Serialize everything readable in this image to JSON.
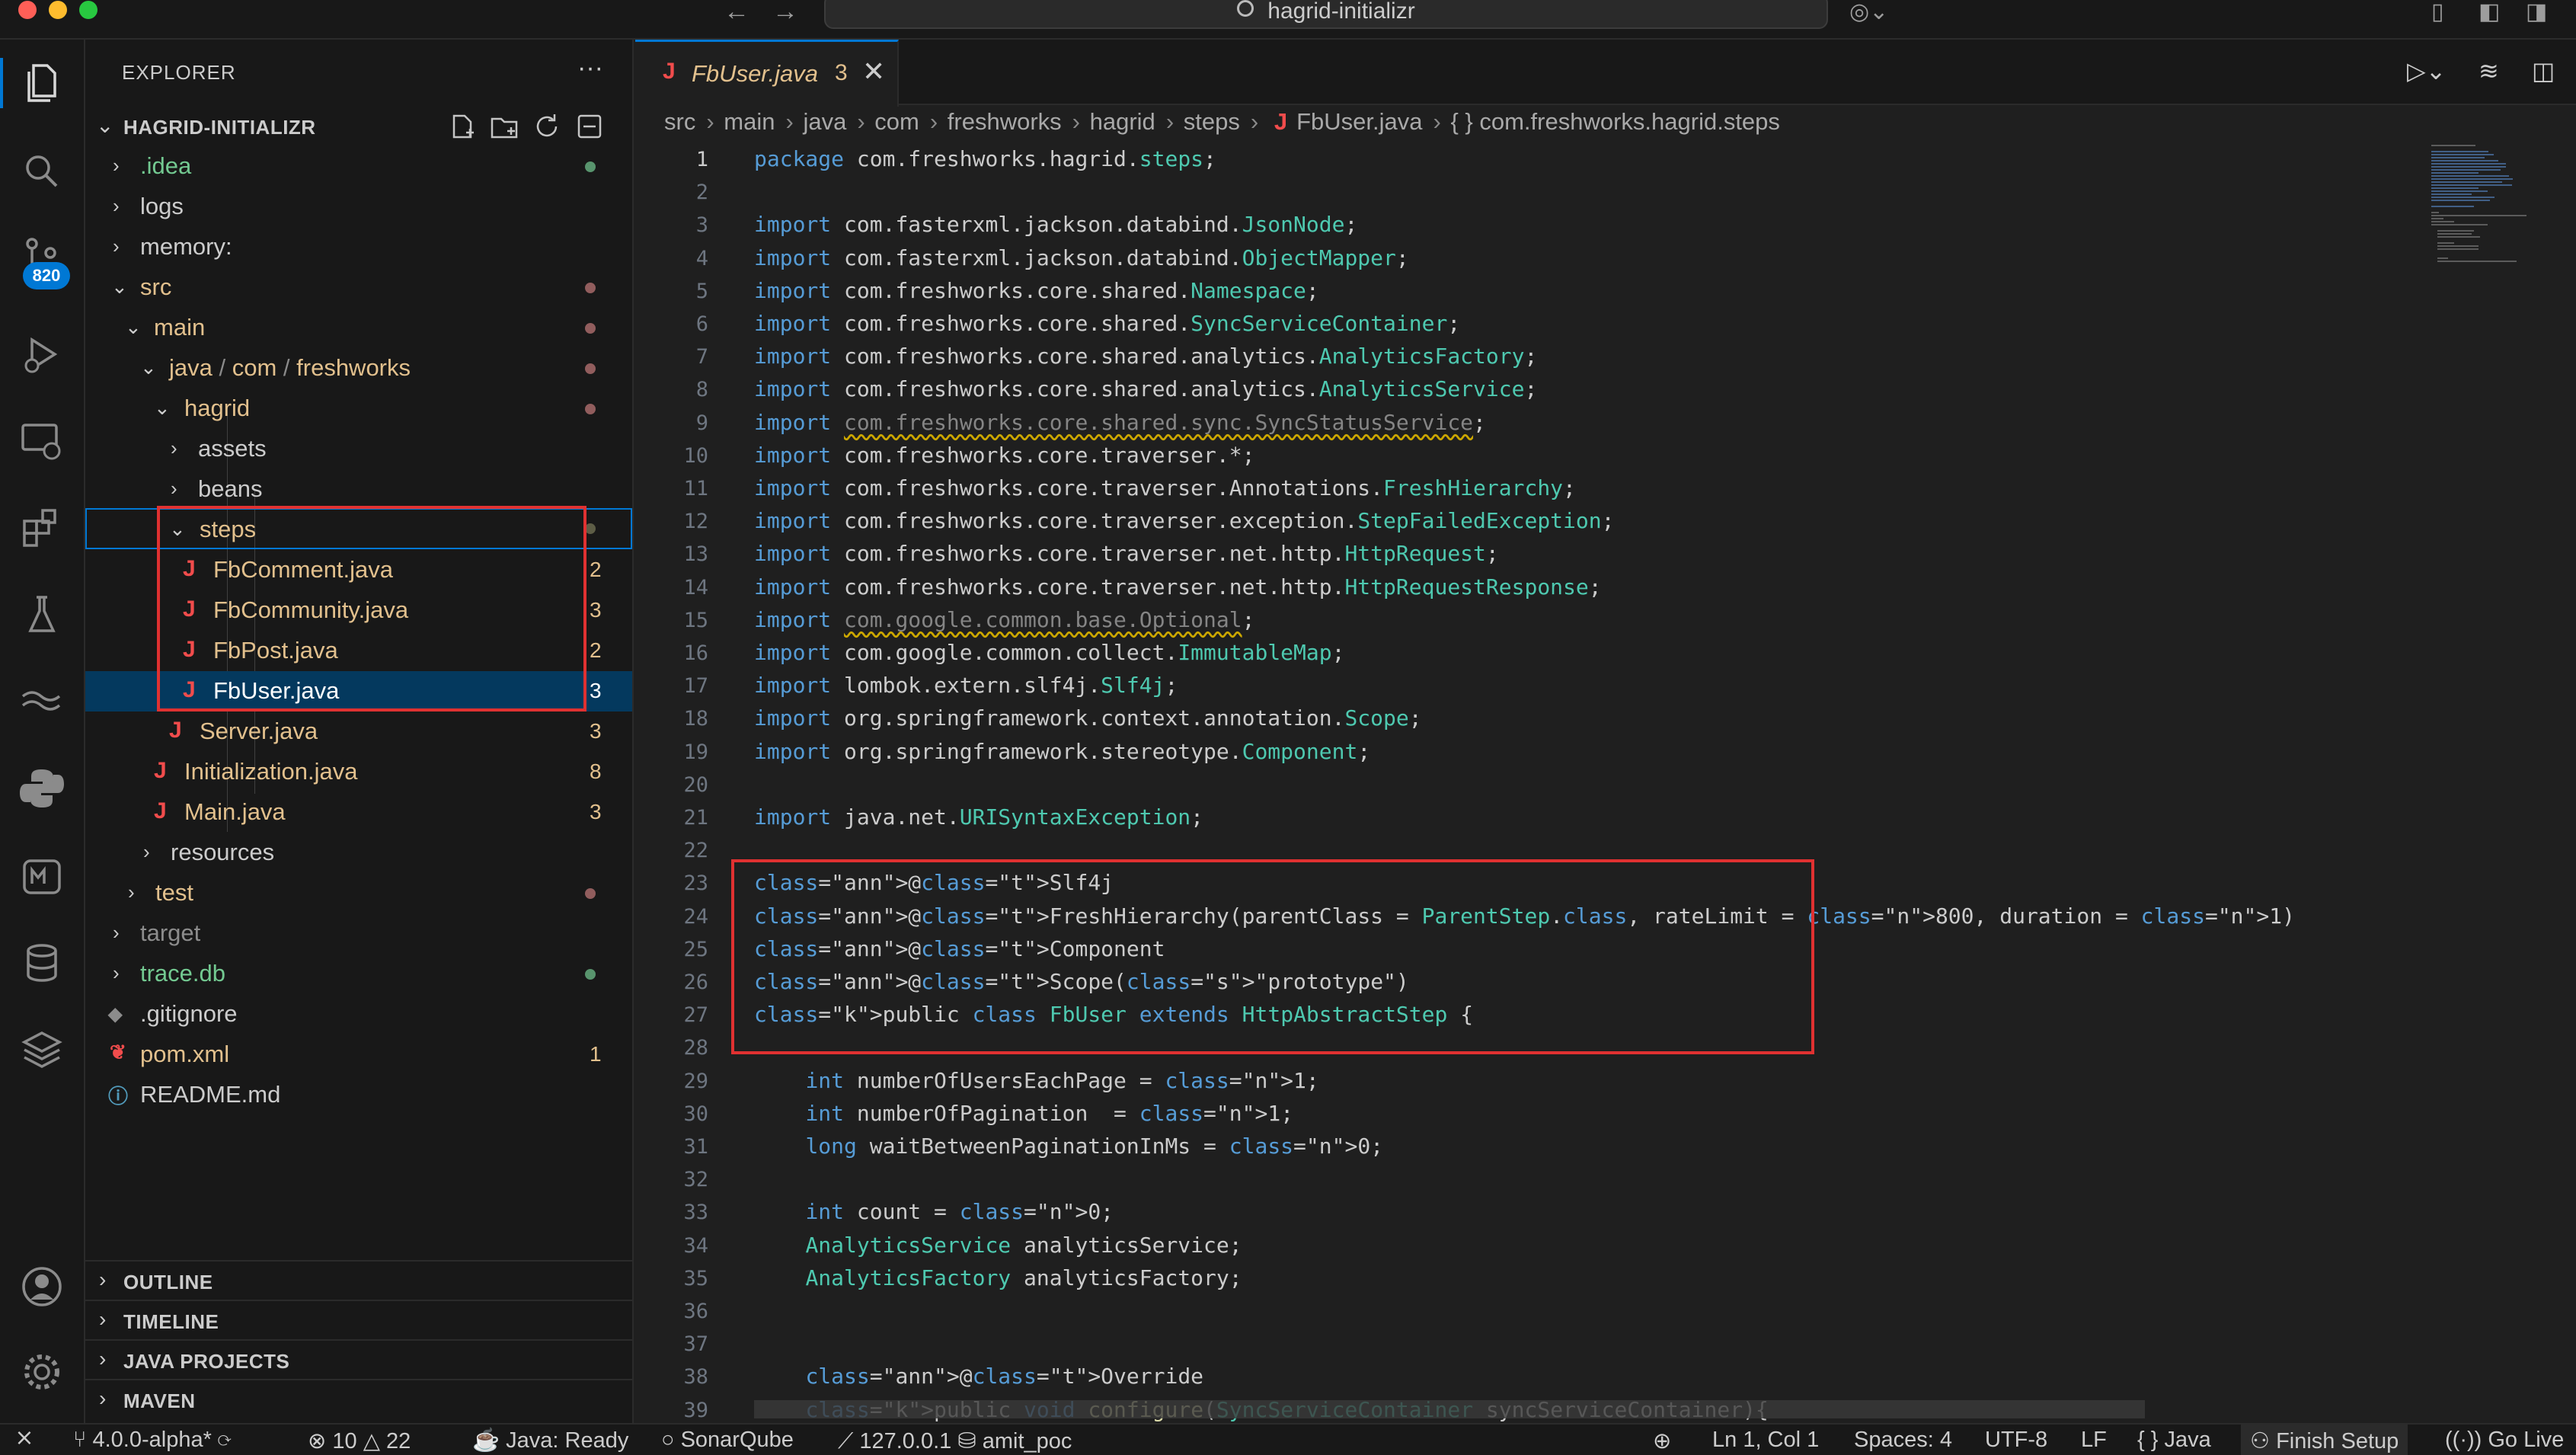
{
  "window": {
    "search_text": "hagrid-initializr"
  },
  "sidebar": {
    "title": "EXPLORER",
    "more": "···",
    "project": "HAGRID-INITIALIZR",
    "tree": [
      {
        "label": ".idea",
        "kind": "folder",
        "open": false
      },
      {
        "label": "logs",
        "kind": "folder",
        "open": false
      },
      {
        "label": "memory:",
        "kind": "folder",
        "open": false
      },
      {
        "label": "src",
        "kind": "folder",
        "open": true
      },
      {
        "label": "main",
        "kind": "folder",
        "open": true
      },
      {
        "label": "java",
        "kind": "folder",
        "open": true,
        "path_parts": [
          "java",
          "com",
          "freshworks"
        ]
      },
      {
        "label": "hagrid",
        "kind": "folder",
        "open": true
      },
      {
        "label": "assets",
        "kind": "folder",
        "open": false
      },
      {
        "label": "beans",
        "kind": "folder",
        "open": false
      },
      {
        "label": "steps",
        "kind": "folder",
        "open": true
      },
      {
        "label": "FbComment.java",
        "kind": "java",
        "count": "2"
      },
      {
        "label": "FbCommunity.java",
        "kind": "java",
        "count": "3"
      },
      {
        "label": "FbPost.java",
        "kind": "java",
        "count": "2"
      },
      {
        "label": "FbUser.java",
        "kind": "java",
        "count": "3"
      },
      {
        "label": "Server.java",
        "kind": "java",
        "count": "3"
      },
      {
        "label": "Initialization.java",
        "kind": "java",
        "count": "8"
      },
      {
        "label": "Main.java",
        "kind": "java",
        "count": "3"
      },
      {
        "label": "resources",
        "kind": "folder",
        "open": false
      },
      {
        "label": "test",
        "kind": "folder",
        "open": false
      },
      {
        "label": "target",
        "kind": "folder",
        "open": false
      },
      {
        "label": "trace.db",
        "kind": "folder",
        "open": false
      },
      {
        "label": ".gitignore",
        "kind": "gitignore"
      },
      {
        "label": "pom.xml",
        "kind": "xml",
        "count": "1"
      },
      {
        "label": "README.md",
        "kind": "md"
      }
    ],
    "panels": [
      "OUTLINE",
      "TIMELINE",
      "JAVA PROJECTS",
      "MAVEN"
    ]
  },
  "scm_badge": "820",
  "editor": {
    "tab": {
      "name": "FbUser.java",
      "count": "3",
      "close": "✕"
    },
    "breadcrumb": [
      "src",
      "main",
      "java",
      "com",
      "freshworks",
      "hagrid",
      "steps",
      "FbUser.java",
      "{ } com.freshworks.hagrid.steps"
    ],
    "line_numbers": [
      "1",
      "2",
      "3",
      "4",
      "5",
      "6",
      "7",
      "8",
      "9",
      "10",
      "11",
      "12",
      "13",
      "14",
      "15",
      "16",
      "17",
      "18",
      "19",
      "20",
      "21",
      "22",
      "23",
      "24",
      "25",
      "26",
      "27",
      "28",
      "29",
      "30",
      "31",
      "32",
      "33",
      "34",
      "35",
      "36",
      "37",
      "38",
      "39"
    ],
    "code": [
      "package com.freshworks.hagrid.steps;",
      "",
      "import com.fasterxml.jackson.databind.JsonNode;",
      "import com.fasterxml.jackson.databind.ObjectMapper;",
      "import com.freshworks.core.shared.Namespace;",
      "import com.freshworks.core.shared.SyncServiceContainer;",
      "import com.freshworks.core.shared.analytics.AnalyticsFactory;",
      "import com.freshworks.core.shared.analytics.AnalyticsService;",
      "import com.freshworks.core.shared.sync.SyncStatusService;",
      "import com.freshworks.core.traverser.*;",
      "import com.freshworks.core.traverser.Annotations.FreshHierarchy;",
      "import com.freshworks.core.traverser.exception.StepFailedException;",
      "import com.freshworks.core.traverser.net.http.HttpRequest;",
      "import com.freshworks.core.traverser.net.http.HttpRequestResponse;",
      "import com.google.common.base.Optional;",
      "import com.google.common.collect.ImmutableMap;",
      "import lombok.extern.slf4j.Slf4j;",
      "import org.springframework.context.annotation.Scope;",
      "import org.springframework.stereotype.Component;",
      "",
      "import java.net.URISyntaxException;",
      "",
      "@Slf4j",
      "@FreshHierarchy(parentClass = ParentStep.class, rateLimit = 800, duration = 1)",
      "@Component",
      "@Scope(\"prototype\")",
      "public class FbUser extends HttpAbstractStep {",
      "",
      "    int numberOfUsersEachPage = 1;",
      "    int numberOfPagination  = 1;",
      "    long waitBetweenPaginationInMs = 0;",
      "",
      "    int count = 0;",
      "    AnalyticsService analyticsService;",
      "    AnalyticsFactory analyticsFactory;",
      "",
      "",
      "    @Override",
      "    public void configure(SyncServiceContainer syncServiceContainer){"
    ]
  },
  "statusbar": {
    "branch": "4.0.0-alpha*",
    "errors": "10",
    "warnings": "22",
    "java": "Java: Ready",
    "sonar": "SonarQube",
    "host": "127.0.0.1",
    "user": "amit_poc",
    "position": "Ln 1, Col 1",
    "spaces": "Spaces: 4",
    "encoding": "UTF-8",
    "eol": "LF",
    "language": "Java",
    "language_icon": "{ }",
    "finish_setup": "Finish Setup",
    "go_live": "Go Live"
  },
  "colors": {
    "accent": "#0078d4",
    "highlight_box": "#e03131",
    "java_icon": "#f14c4c",
    "modified_file": "#e2c08d",
    "untracked_file": "#73c991"
  }
}
